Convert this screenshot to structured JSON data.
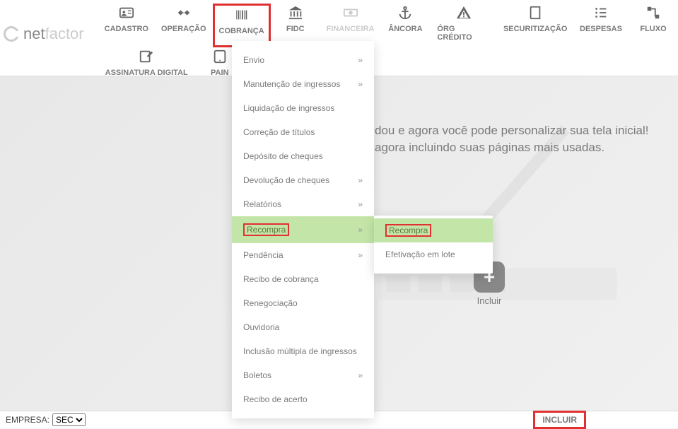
{
  "logo": {
    "prefix": "net",
    "suffix": "factor"
  },
  "nav": {
    "row1": [
      {
        "label": "CADASTRO",
        "icon": "id-card"
      },
      {
        "label": "OPERAÇÃO",
        "icon": "handshake"
      },
      {
        "label": "COBRANÇA",
        "icon": "barcode",
        "highlighted": true
      },
      {
        "label": "FIDC",
        "icon": "bank"
      },
      {
        "label": "FINANCEIRA",
        "icon": "money",
        "faded": true
      },
      {
        "label": "ÂNCORA",
        "icon": "anchor"
      },
      {
        "label": "ÓRG CRÉDITO",
        "icon": "warning"
      },
      {
        "label": "SECURITIZAÇÃO",
        "icon": "book"
      },
      {
        "label": "DESPESAS",
        "icon": "list"
      },
      {
        "label": "FLUXO",
        "icon": "flow",
        "cut": true
      }
    ],
    "row2": [
      {
        "label": "ASSINATURA DIGITAL",
        "icon": "edit"
      },
      {
        "label": "PAIN",
        "icon": "tablet",
        "cut": true
      }
    ]
  },
  "dropdown": {
    "items": [
      {
        "label": "Envio",
        "hasSubmenu": true
      },
      {
        "label": "Manutenção de ingressos",
        "hasSubmenu": true
      },
      {
        "label": "Liquidação de ingressos"
      },
      {
        "label": "Correção de títulos"
      },
      {
        "label": "Depósito de cheques"
      },
      {
        "label": "Devolução de cheques",
        "hasSubmenu": true
      },
      {
        "label": "Relatórios",
        "hasSubmenu": true
      },
      {
        "label": "Recompra",
        "hasSubmenu": true,
        "active": true,
        "highlighted": true
      },
      {
        "label": "Pendência",
        "hasSubmenu": true
      },
      {
        "label": "Recibo de cobrança"
      },
      {
        "label": "Renegociação"
      },
      {
        "label": "Ouvidoria"
      },
      {
        "label": "Inclusão múltipla de ingressos"
      },
      {
        "label": "Boletos",
        "hasSubmenu": true
      },
      {
        "label": "Recibo de acerto"
      }
    ]
  },
  "submenu": {
    "items": [
      {
        "label": "Recompra",
        "active": true,
        "highlighted": true
      },
      {
        "label": "Efetivação em lote"
      }
    ]
  },
  "hero": {
    "line1": "dou e agora você pode personalizar sua tela inicial!",
    "line2": "agora incluindo suas páginas mais usadas."
  },
  "incluir_center": {
    "label": "Incluir",
    "plus": "+"
  },
  "footer": {
    "empresa_label": "EMPRESA:",
    "empresa_value": "SEC",
    "incluir_button": "INCLUIR"
  }
}
